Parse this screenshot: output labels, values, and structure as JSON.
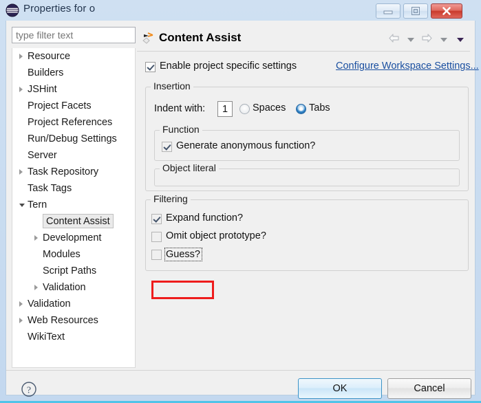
{
  "window": {
    "title": "Properties for o",
    "icon": "eclipse-logo-icon",
    "buttons": {
      "minimize": "minimize-icon",
      "maximize": "maximize-icon",
      "close": "close-icon"
    }
  },
  "sidebar": {
    "filter": {
      "placeholder": "type filter text",
      "value": ""
    },
    "items": [
      {
        "label": "Resource",
        "indent": 0,
        "arrow": "collapsed",
        "selected": false
      },
      {
        "label": "Builders",
        "indent": 0,
        "arrow": "none",
        "selected": false
      },
      {
        "label": "JSHint",
        "indent": 0,
        "arrow": "collapsed",
        "selected": false
      },
      {
        "label": "Project Facets",
        "indent": 0,
        "arrow": "none",
        "selected": false
      },
      {
        "label": "Project References",
        "indent": 0,
        "arrow": "none",
        "selected": false
      },
      {
        "label": "Run/Debug Settings",
        "indent": 0,
        "arrow": "none",
        "selected": false
      },
      {
        "label": "Server",
        "indent": 0,
        "arrow": "none",
        "selected": false
      },
      {
        "label": "Task Repository",
        "indent": 0,
        "arrow": "collapsed",
        "selected": false
      },
      {
        "label": "Task Tags",
        "indent": 0,
        "arrow": "none",
        "selected": false
      },
      {
        "label": "Tern",
        "indent": 0,
        "arrow": "expanded",
        "selected": false
      },
      {
        "label": "Content Assist",
        "indent": 1,
        "arrow": "none",
        "selected": true
      },
      {
        "label": "Development",
        "indent": 1,
        "arrow": "collapsed",
        "selected": false
      },
      {
        "label": "Modules",
        "indent": 1,
        "arrow": "none",
        "selected": false
      },
      {
        "label": "Script Paths",
        "indent": 1,
        "arrow": "none",
        "selected": false
      },
      {
        "label": "Validation",
        "indent": 1,
        "arrow": "collapsed",
        "selected": false
      },
      {
        "label": "Validation",
        "indent": 0,
        "arrow": "collapsed",
        "selected": false
      },
      {
        "label": "Web Resources",
        "indent": 0,
        "arrow": "collapsed",
        "selected": false
      },
      {
        "label": "WikiText",
        "indent": 0,
        "arrow": "none",
        "selected": false
      }
    ]
  },
  "page": {
    "icon": "tern-content-assist-icon",
    "title": "Content Assist",
    "nav": {
      "back": "back-arrow-icon",
      "back_menu": "chevron-down-icon",
      "forward": "forward-arrow-icon",
      "forward_menu": "chevron-down-icon",
      "view_menu": "chevron-down-icon"
    },
    "enable_specific": {
      "label": "Enable project specific settings",
      "checked": true
    },
    "configure_link": "Configure Workspace Settings...",
    "insertion": {
      "title": "Insertion",
      "indent_label": "Indent with:",
      "indent_value": "1",
      "radio_spaces": "Spaces",
      "radio_tabs": "Tabs",
      "selected_radio": "Tabs",
      "function": {
        "title": "Function",
        "generate_anonymous": "Generate anonymous function?",
        "generate_anonymous_checked": true
      },
      "object_literal": {
        "title": "Object literal"
      }
    },
    "filtering": {
      "title": "Filtering",
      "options": [
        {
          "label": "Expand function?",
          "checked": true
        },
        {
          "label": "Omit object prototype?",
          "checked": false
        },
        {
          "label": "Guess?",
          "checked": false,
          "focused": true,
          "highlighted": true
        }
      ]
    }
  },
  "footer": {
    "help": "help-icon",
    "ok": "OK",
    "cancel": "Cancel"
  },
  "colors": {
    "accent": "#1a4fa0",
    "highlight": "#ee1c1c",
    "titlebar": "#cfe0f2",
    "default_button_border": "#3c93c6"
  }
}
